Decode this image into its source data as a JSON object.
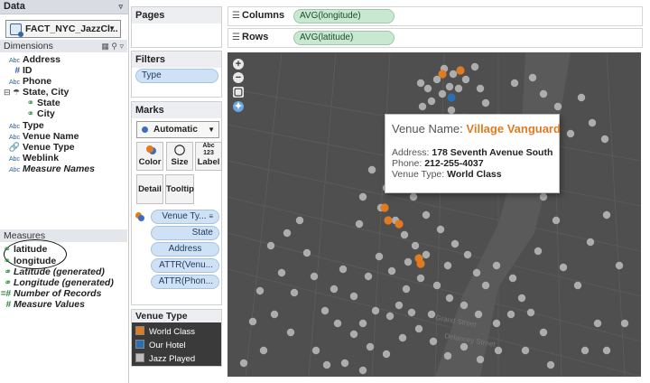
{
  "data_pane": {
    "title": "Data",
    "datasource": "FACT_NYC_JazzCl...",
    "dimensions_label": "Dimensions",
    "measures_label": "Measures",
    "dimensions": [
      {
        "type": "Abc",
        "label": "Address"
      },
      {
        "type": "#",
        "label": "ID"
      },
      {
        "type": "Abc",
        "label": "Phone"
      },
      {
        "type": "hier",
        "label": "State, City"
      },
      {
        "type": "globe",
        "label": "State"
      },
      {
        "type": "globe",
        "label": "City"
      },
      {
        "type": "Abc",
        "label": "Type"
      },
      {
        "type": "Abc",
        "label": "Venue Name"
      },
      {
        "type": "link",
        "label": "Venue Type"
      },
      {
        "type": "Abc",
        "label": "Weblink"
      },
      {
        "type": "Abc",
        "label": "Measure Names"
      }
    ],
    "measures": [
      {
        "type": "globe",
        "label": "latitude"
      },
      {
        "type": "globe",
        "label": "longitude"
      },
      {
        "type": "globe",
        "label": "Latitude (generated)"
      },
      {
        "type": "globe",
        "label": "Longitude (generated)"
      },
      {
        "type": "#",
        "label": "Number of Records"
      },
      {
        "type": "#",
        "label": "Measure Values"
      }
    ]
  },
  "pages": {
    "title": "Pages"
  },
  "filters": {
    "title": "Filters",
    "items": [
      "Type"
    ]
  },
  "marks": {
    "title": "Marks",
    "mark_type": "Automatic",
    "buttons": {
      "color": "Color",
      "size": "Size",
      "label": "Label",
      "detail": "Detail",
      "tooltip": "Tooltip"
    },
    "fields": [
      "Venue Ty...",
      "State",
      "Address",
      "ATTR(Venu...",
      "ATTR(Phon..."
    ]
  },
  "legend": {
    "title": "Venue Type",
    "items": [
      {
        "label": "World Class",
        "color": "#e07b21"
      },
      {
        "label": "Our Hotel",
        "color": "#2a6fb5"
      },
      {
        "label": "Jazz Played",
        "color": "#bdbdbd"
      }
    ]
  },
  "shelves": {
    "columns_label": "Columns",
    "columns_pill": "AVG(longitude)",
    "rows_label": "Rows",
    "rows_pill": "AVG(latitude)"
  },
  "map": {
    "controls": [
      "zoom-in",
      "zoom-out",
      "select",
      "pin"
    ],
    "street_labels": [
      "Grand Street",
      "Delancey Street"
    ]
  },
  "tooltip": {
    "name_label": "Venue Name:",
    "name_value": "Village Vanguard",
    "address_label": "Address:",
    "address_value": "178 Seventh Avenue South",
    "phone_label": "Phone:",
    "phone_value": "212-255-4037",
    "type_label": "Venue Type:",
    "type_value": "World Class"
  },
  "colors": {
    "world_class": "#e07b21",
    "our_hotel": "#2a6fb5",
    "jazz_played": "#bdbdbd",
    "map_land": "#4f4f4f",
    "water": "#5d5d5d"
  }
}
